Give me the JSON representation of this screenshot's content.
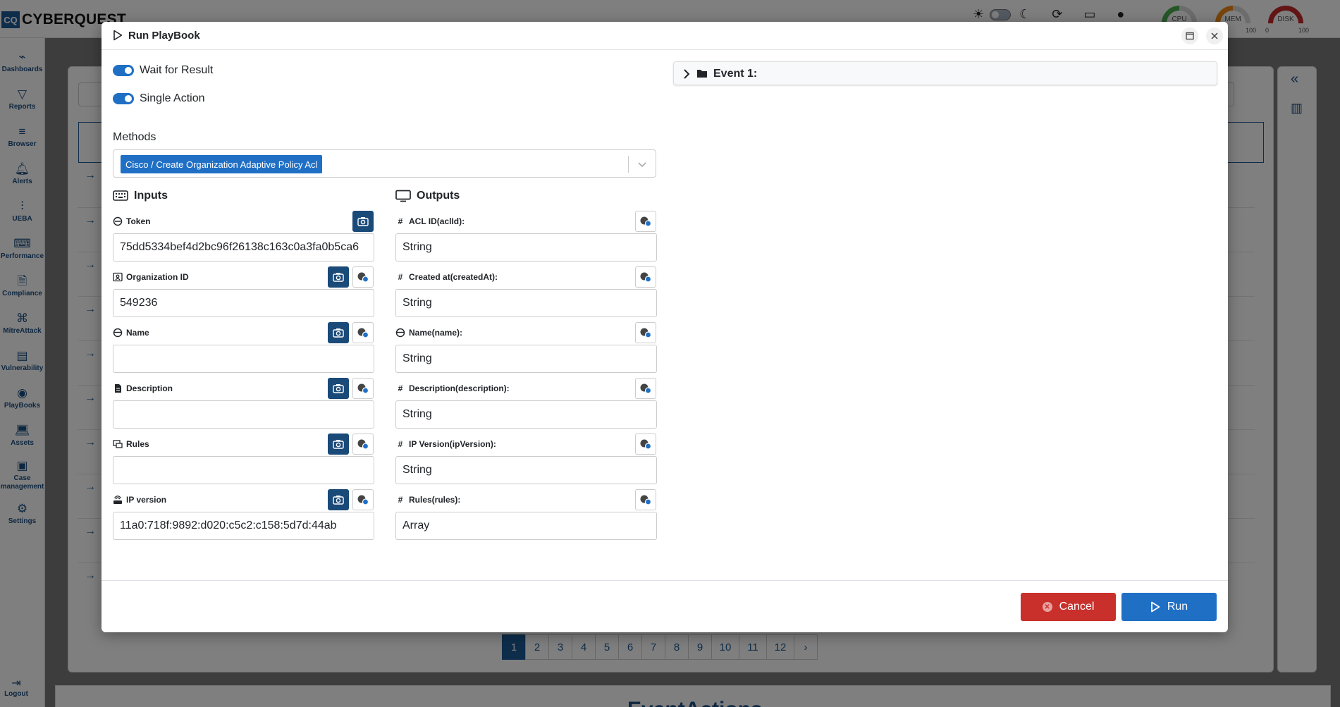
{
  "app": {
    "brand_logo": "CQ",
    "brand_name": "CYBERQUEST"
  },
  "topbar": {
    "gauges": [
      {
        "label": "CPU",
        "min": "",
        "max": "",
        "color": "#4caf50"
      },
      {
        "label": "MEM",
        "min": "0",
        "max": "100",
        "color": "#ef8a17"
      },
      {
        "label": "DISK",
        "min": "0",
        "max": "100",
        "color": "#c62828"
      }
    ]
  },
  "sidebar": {
    "items": [
      {
        "label": "Dashboards",
        "icon": "dashboard-chart-icon"
      },
      {
        "label": "Reports",
        "icon": "filter-funnel-icon"
      },
      {
        "label": "Browser",
        "icon": "list-icon"
      },
      {
        "label": "Alerts",
        "icon": "bell-icon"
      },
      {
        "label": "UEBA",
        "icon": "bar-chart-icon"
      },
      {
        "label": "Performance",
        "icon": "keyboard-icon"
      },
      {
        "label": "Compliance",
        "icon": "file-check-icon"
      },
      {
        "label": "MitreAttack",
        "icon": "command-icon"
      },
      {
        "label": "Vulnerability",
        "icon": "server-icon"
      },
      {
        "label": "PlayBooks",
        "icon": "playbook-icon"
      },
      {
        "label": "Assets",
        "icon": "laptop-icon"
      },
      {
        "label": "Case management",
        "icon": "briefcase-icon"
      },
      {
        "label": "Settings",
        "icon": "gear-icon"
      }
    ],
    "logout": "Logout"
  },
  "pagination": {
    "pages": [
      "1",
      "2",
      "3",
      "4",
      "5",
      "6",
      "7",
      "8",
      "9",
      "10",
      "11",
      "12"
    ],
    "active": "1",
    "next": "›"
  },
  "background": {
    "section_title": "EventActions"
  },
  "modal": {
    "title": "Run PlayBook",
    "toggles": {
      "wait_for_result": "Wait for Result",
      "single_action": "Single Action"
    },
    "methods": {
      "label": "Methods",
      "selected": "Cisco / Create Organization Adaptive Policy Acl"
    },
    "inputs": {
      "title": "Inputs",
      "fields": [
        {
          "label": "Token",
          "value": "75dd5334bef4d2bc96f26138c163c0a3fa0b5ca6"
        },
        {
          "label": "Organization ID",
          "value": "549236"
        },
        {
          "label": "Name",
          "value": ""
        },
        {
          "label": "Description",
          "value": ""
        },
        {
          "label": "Rules",
          "value": ""
        },
        {
          "label": "IP version",
          "value": "11a0:718f:9892:d020:c5c2:c158:5d7d:44ab"
        }
      ]
    },
    "outputs": {
      "title": "Outputs",
      "fields": [
        {
          "label": "ACL ID(aclId):",
          "value": "String"
        },
        {
          "label": "Created at(createdAt):",
          "value": "String"
        },
        {
          "label": "Name(name):",
          "value": "String"
        },
        {
          "label": "Description(description):",
          "value": "String"
        },
        {
          "label": "IP Version(ipVersion):",
          "value": "String"
        },
        {
          "label": "Rules(rules):",
          "value": "Array"
        }
      ]
    },
    "event": {
      "title": "Event 1:"
    },
    "buttons": {
      "cancel": "Cancel",
      "run": "Run"
    }
  }
}
